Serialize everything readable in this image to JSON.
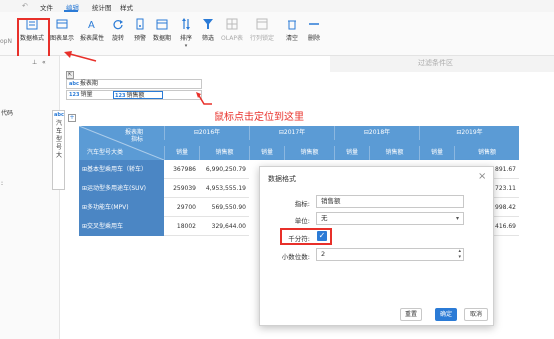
{
  "menubar": {
    "tabs": [
      "文件",
      "编辑",
      "统计图",
      "样式"
    ]
  },
  "toolbar": {
    "left_cut": "opN",
    "items": [
      {
        "label": "数据格式"
      },
      {
        "label": "图表显示"
      },
      {
        "label": "报表属性"
      },
      {
        "label": "旋转"
      },
      {
        "label": "预警"
      },
      {
        "label": "数据期"
      },
      {
        "label": "排序"
      },
      {
        "label": "筛选"
      },
      {
        "label": "OLAP表"
      },
      {
        "label": "行列锁定"
      },
      {
        "label": "清空"
      },
      {
        "label": "删除"
      }
    ],
    "filter_zone": "过滤条件区"
  },
  "panel": {
    "collapse_glyph": "« ",
    "pin_glyph": "⊥",
    "left_label": "代码"
  },
  "fields": {
    "abc_tag": "abc",
    "f1": "报表期",
    "f2": "销量",
    "f3": "销售额",
    "row_dim": "汽车型号大",
    "row_dim_tag": "abc"
  },
  "annotation": "鼠标点击定位到这里",
  "table": {
    "corner_top": "报表期",
    "corner_mid": "指标",
    "corner_bottom": "汽车型号大类",
    "years": [
      "2016年",
      "2017年",
      "2018年",
      "2019年"
    ],
    "measures": [
      "销量",
      "销售额"
    ],
    "rows": [
      {
        "label": "基本型乘用车（轿车）",
        "v2016": [
          "367986",
          "6,990,250.79"
        ],
        "v2019b": "891.67"
      },
      {
        "label": "运动型多用途车(SUV)",
        "v2016": [
          "259039",
          "4,953,555.19"
        ],
        "v2019b": "723.11"
      },
      {
        "label": "多功能车(MPV)",
        "v2016": [
          "29700",
          "569,550.90"
        ],
        "v2019b": "998.42"
      },
      {
        "label": "交叉型乘用车",
        "v2016": [
          "18002",
          "329,644.00"
        ],
        "v2019b": "416.69"
      }
    ]
  },
  "dialog": {
    "title": "数据格式",
    "close": "×",
    "metric_label": "指标:",
    "metric_value": "销售额",
    "unit_label": "单位:",
    "unit_value": "无",
    "thousand_label": "千分符:",
    "thousand_checked": true,
    "decimals_label": "小数位数:",
    "decimals_value": "2",
    "btn_reset": "重置",
    "btn_ok": "确定",
    "btn_cancel": "取消"
  },
  "colors": {
    "accent": "#2b7bd6",
    "highlight": "#e8302a",
    "table_header": "#5b9bd5"
  }
}
